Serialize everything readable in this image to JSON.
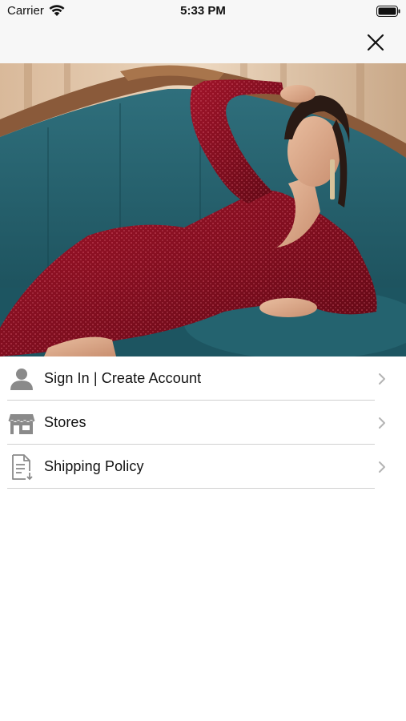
{
  "status_bar": {
    "carrier": "Carrier",
    "time": "5:33 PM",
    "icons": [
      "wifi-icon",
      "battery-icon"
    ]
  },
  "nav": {
    "close_icon": "close-icon"
  },
  "hero": {
    "image": "woman-red-sequin-dress-on-teal-sofa"
  },
  "menu": {
    "items": [
      {
        "label": "Sign In | Create Account",
        "icon": "user-icon"
      },
      {
        "label": "Stores",
        "icon": "store-icon"
      },
      {
        "label": "Shipping Policy",
        "icon": "document-download-icon"
      }
    ],
    "chevron_icon": "chevron-right-icon"
  },
  "colors": {
    "nav_background": "#f7f7f7",
    "divider": "#d0d0d0",
    "icon_gray": "#8a8a8a",
    "chevron_gray": "#b4b4b4"
  }
}
